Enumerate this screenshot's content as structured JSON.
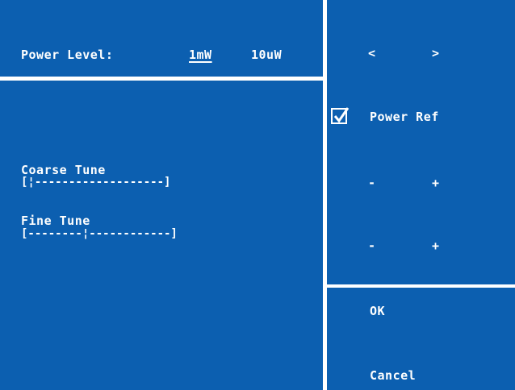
{
  "power_level": {
    "label": "Power Level:",
    "options": [
      "1mW",
      "10uW"
    ]
  },
  "coarse_tune": {
    "label": "Coarse Tune",
    "bar": "[¦-------------------]"
  },
  "fine_tune": {
    "label": "Fine Tune",
    "bar": "[--------¦------------]"
  },
  "nav": {
    "prev": "<",
    "next": ">"
  },
  "power_ref": {
    "label": "Power Ref",
    "checked": true
  },
  "coarse_controls": {
    "minus": "-",
    "plus": "+"
  },
  "fine_controls": {
    "minus": "-",
    "plus": "+"
  },
  "actions": {
    "ok": "OK",
    "cancel": "Cancel"
  },
  "colors": {
    "background": "#0c5fb0",
    "foreground": "#ffffff"
  }
}
